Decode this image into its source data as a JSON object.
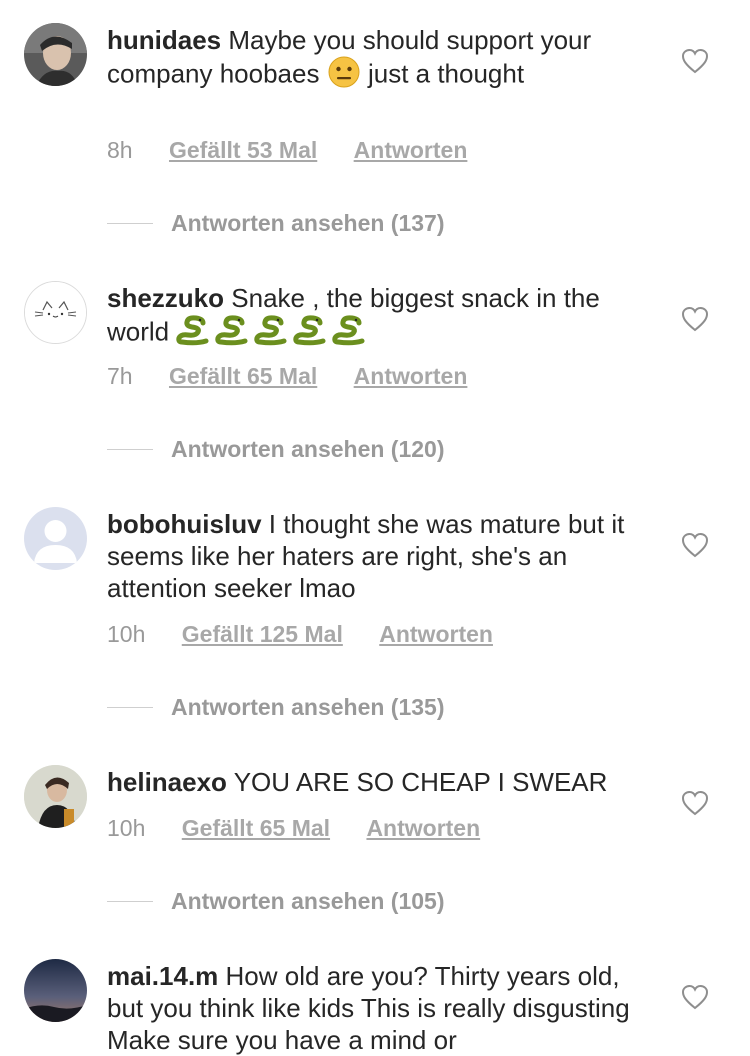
{
  "comments": [
    {
      "username": "hunidaes",
      "text_before": "Maybe you should support your company hoobaes",
      "emoji": "neutral-face",
      "text_after": "just a thought",
      "time": "8h",
      "likes": "Gefällt 53 Mal",
      "reply": "Antworten",
      "view_replies": "Antworten ansehen (137)"
    },
    {
      "username": "shezzuko",
      "text_before": "Snake , the biggest snack in the world",
      "emoji": "snake x5",
      "text_after": "",
      "time": "7h",
      "likes": "Gefällt 65 Mal",
      "reply": "Antworten",
      "view_replies": "Antworten ansehen (120)"
    },
    {
      "username": "bobohuisluv",
      "text_before": "I thought she was mature but it seems like her haters are right, she's an attention seeker lmao",
      "time": "10h",
      "likes": "Gefällt 125 Mal",
      "reply": "Antworten",
      "view_replies": "Antworten ansehen (135)"
    },
    {
      "username": "helinaexo",
      "text_before": "YOU ARE SO CHEAP I SWEAR",
      "time": "10h",
      "likes": "Gefällt 65 Mal",
      "reply": "Antworten",
      "view_replies": "Antworten ansehen (105)"
    },
    {
      "username": "mai.14.m",
      "text_before": "How old are you? Thirty years old, but you think like kids This is really disgusting Make sure you have a mind or"
    }
  ],
  "colors": {
    "text": "#262626",
    "meta": "#999999",
    "divider": "#cfcfcf"
  }
}
